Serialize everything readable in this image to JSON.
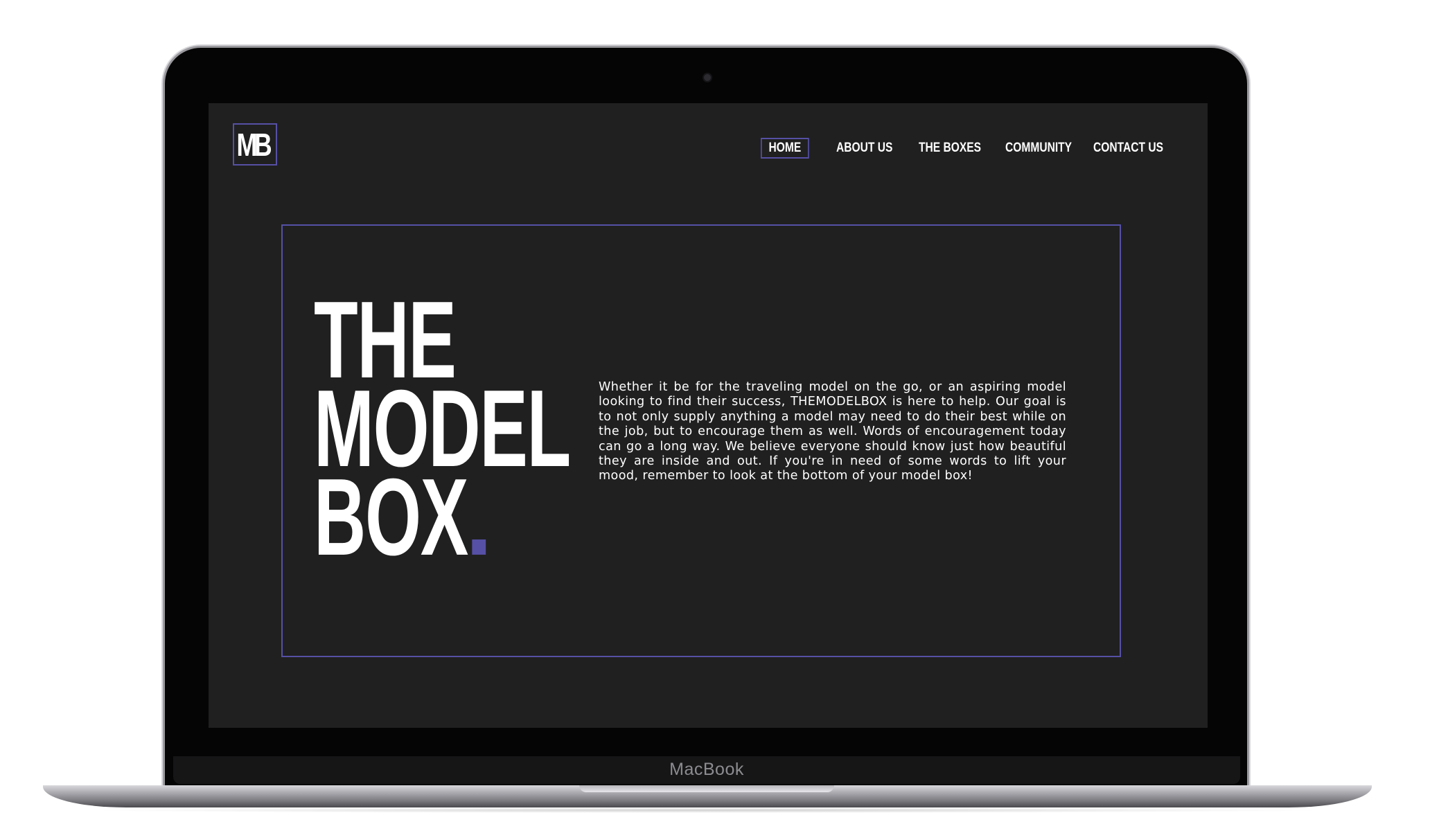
{
  "device": {
    "label": "MacBook"
  },
  "site": {
    "logo_text": "MB",
    "accent_color": "#5650a6",
    "background_color": "#202020"
  },
  "nav": {
    "items": [
      {
        "label": "HOME",
        "active": true
      },
      {
        "label": "ABOUT US",
        "active": false
      },
      {
        "label": "THE BOXES",
        "active": false
      },
      {
        "label": "COMMUNITY",
        "active": false
      },
      {
        "label": "CONTACT US",
        "active": false
      }
    ]
  },
  "hero": {
    "title_lines": [
      "THE",
      "MODEL",
      "BOX"
    ],
    "title_period": ".",
    "body": "Whether it be for the traveling model on the go, or an aspiring model looking to find their success, THEMODELBOX is here to help. Our goal is to not only supply anything a model may need to do their best while on the job, but to encourage them as well. Words of encouragement today can go a long way. We believe everyone should know just how beautiful they are inside and out. If you're in need of some words to lift your mood, remember to look at the bottom of your model box!"
  }
}
